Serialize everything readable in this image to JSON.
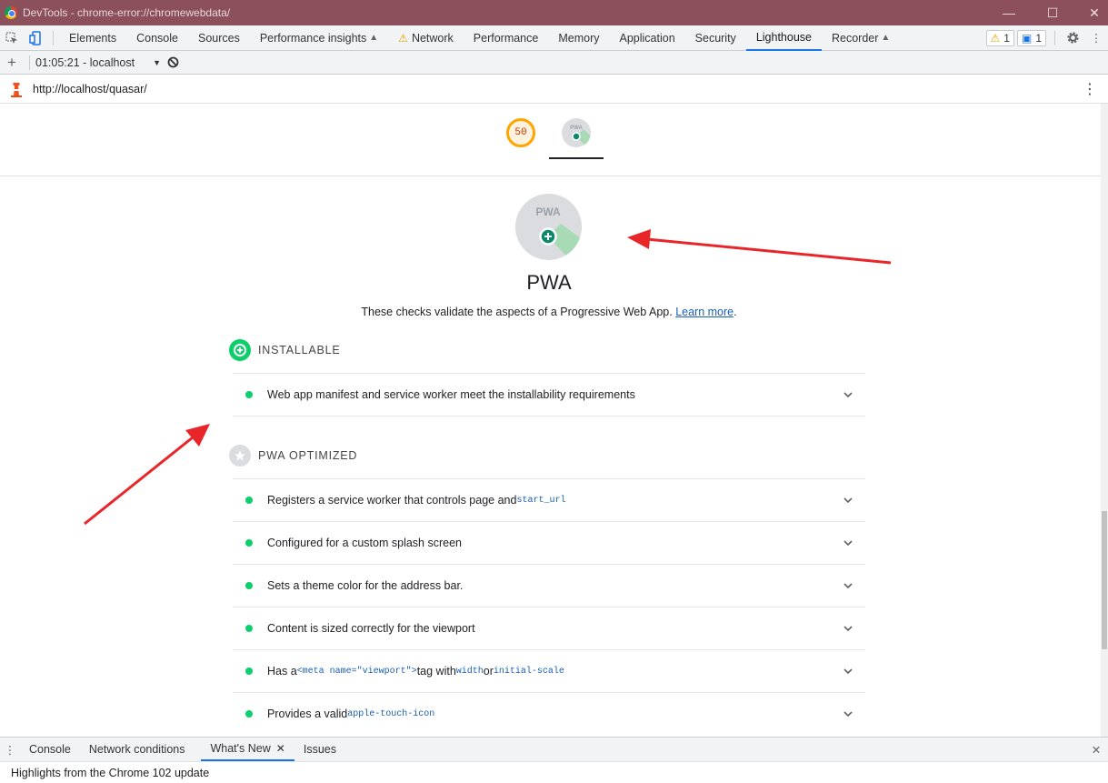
{
  "window": {
    "title": "DevTools - chrome-error://chromewebdata/"
  },
  "tabs": [
    {
      "label": "Elements",
      "flask": false
    },
    {
      "label": "Console",
      "flask": false
    },
    {
      "label": "Sources",
      "flask": false
    },
    {
      "label": "Performance insights",
      "flask": true
    },
    {
      "label": "Network",
      "flask": false,
      "warning": true
    },
    {
      "label": "Performance",
      "flask": false
    },
    {
      "label": "Memory",
      "flask": false
    },
    {
      "label": "Application",
      "flask": false
    },
    {
      "label": "Security",
      "flask": false
    },
    {
      "label": "Lighthouse",
      "flask": false,
      "active": true
    },
    {
      "label": "Recorder",
      "flask": true
    }
  ],
  "badges": {
    "warnings": "1",
    "messages": "1"
  },
  "report_selector": {
    "value": "01:05:21 - localhost"
  },
  "url": "http://localhost/quasar/",
  "scores": {
    "performance": "50",
    "pwa_mini_label": "PWA"
  },
  "pwa": {
    "badge_label": "PWA",
    "title": "PWA",
    "description": "These checks validate the aspects of a Progressive Web App.",
    "learn_more": "Learn more",
    "period": "."
  },
  "groups": {
    "installable": {
      "title": "INSTALLABLE",
      "audits": [
        {
          "text": "Web app manifest and service worker meet the installability requirements"
        }
      ]
    },
    "optimized": {
      "title": "PWA OPTIMIZED",
      "audits": [
        {
          "text": "Registers a service worker that controls page and ",
          "code": "start_url"
        },
        {
          "text": "Configured for a custom splash screen"
        },
        {
          "text": "Sets a theme color for the address bar."
        },
        {
          "text": "Content is sized correctly for the viewport"
        },
        {
          "pre": "Has a ",
          "code1": "<meta name=\"viewport\">",
          "mid": " tag with ",
          "code2": "width",
          "mid2": " or ",
          "code3": "initial-scale"
        },
        {
          "text": "Provides a valid ",
          "code": "apple-touch-icon"
        }
      ]
    }
  },
  "drawer": {
    "tabs": [
      "Console",
      "Network conditions",
      "What's New",
      "Issues"
    ],
    "active": "What's New",
    "content": "Highlights from the Chrome 102 update"
  },
  "colors": {
    "pass": "#0cce6b",
    "accent": "#1a73e8",
    "titlebar": "#8c4f5c",
    "arrow": "#e8262a"
  }
}
